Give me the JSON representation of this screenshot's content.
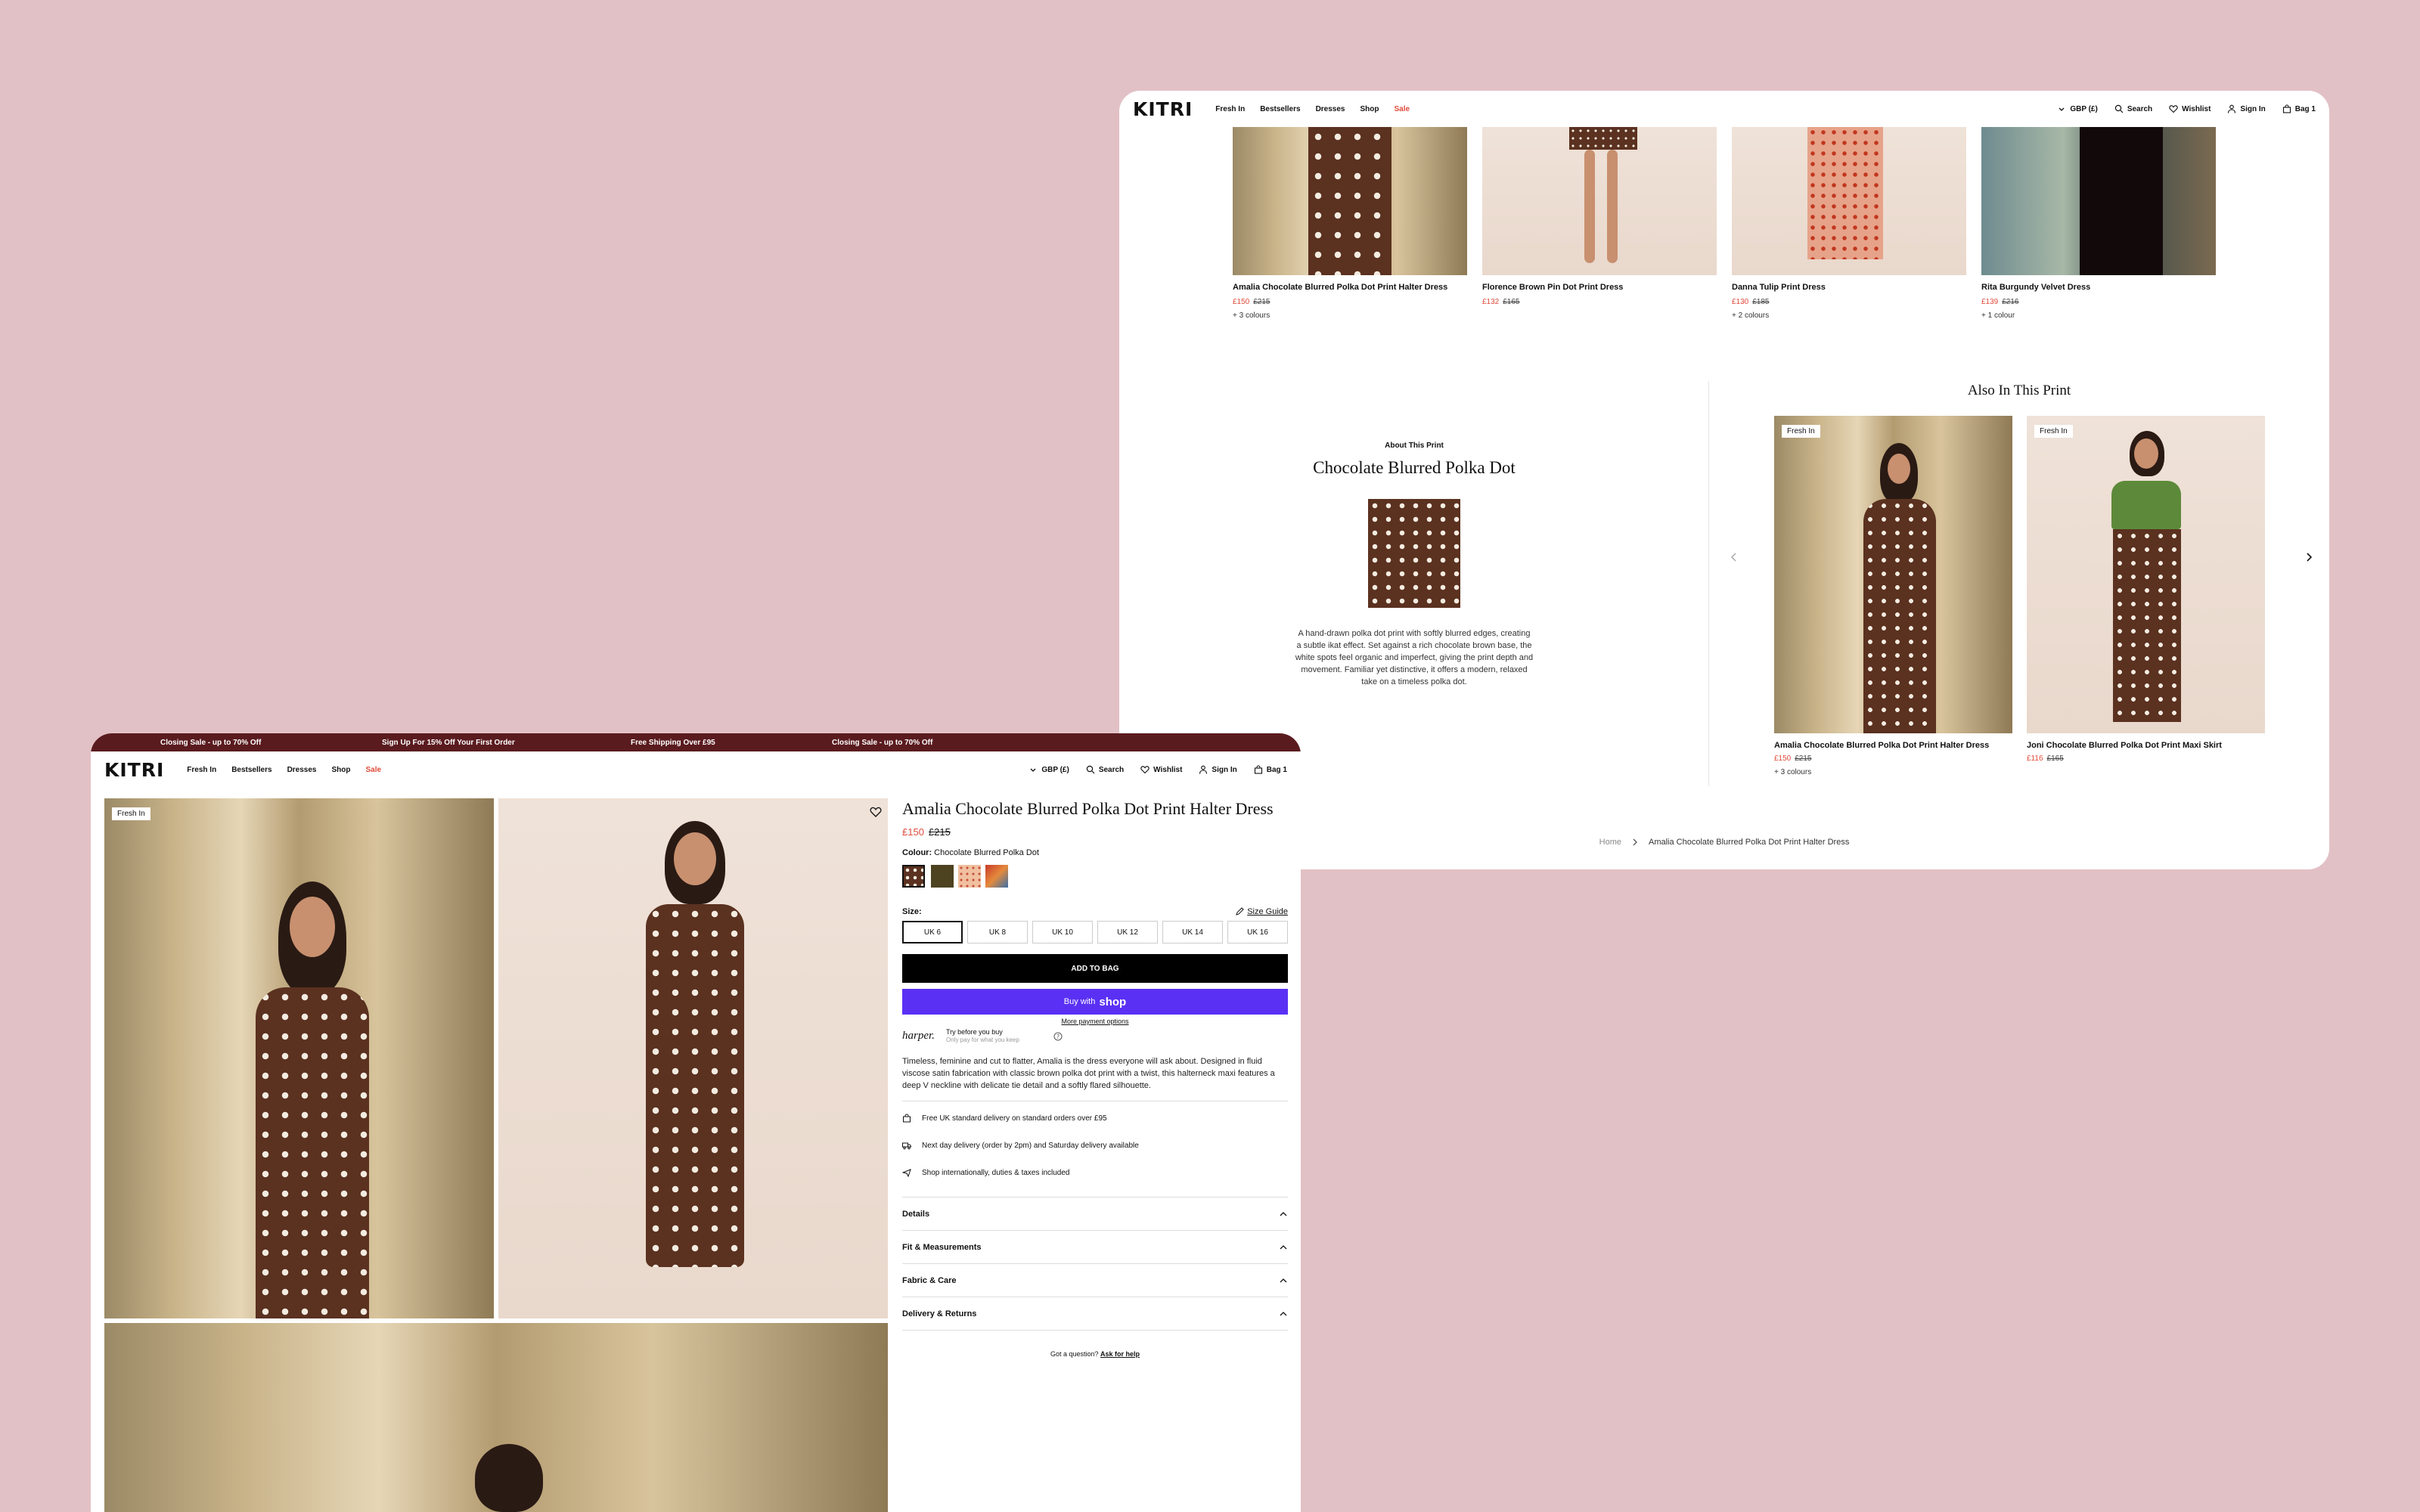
{
  "nav": {
    "logo": "KITRI",
    "links": [
      "Fresh In",
      "Bestsellers",
      "Dresses",
      "Shop",
      "Sale"
    ],
    "currency": "GBP (£)",
    "search": "Search",
    "wishlist": "Wishlist",
    "signin": "Sign In",
    "bag": "Bag 1"
  },
  "promo": [
    "Closing Sale - up to 70% Off",
    "Sign Up For 15% Off Your First Order",
    "Free Shipping Over £95",
    "Closing Sale - up to 70% Off"
  ],
  "top_products": [
    {
      "name": "Amalia Chocolate Blurred Polka Dot Print Halter Dress",
      "price": "£150",
      "was": "£215",
      "colours": "+ 3 colours"
    },
    {
      "name": "Florence Brown Pin Dot Print Dress",
      "price": "£132",
      "was": "£165",
      "colours": ""
    },
    {
      "name": "Danna Tulip Print Dress",
      "price": "£130",
      "was": "£185",
      "colours": "+ 2 colours"
    },
    {
      "name": "Rita Burgundy Velvet Dress",
      "price": "£139",
      "was": "£216",
      "colours": "+ 1 colour"
    }
  ],
  "about": {
    "eyebrow": "About This Print",
    "title": "Chocolate Blurred Polka Dot",
    "text": "A hand-drawn polka dot print with softly blurred edges, creating a subtle ikat effect. Set against a rich chocolate brown base, the white spots feel organic and imperfect, giving the print depth and movement. Familiar yet distinctive, it offers a modern, relaxed take on a timeless polka dot."
  },
  "also": {
    "title": "Also In This Print",
    "items": [
      {
        "tag": "Fresh In",
        "name": "Amalia Chocolate Blurred Polka Dot Print Halter Dress",
        "price": "£150",
        "was": "£215",
        "colours": "+ 3 colours"
      },
      {
        "tag": "Fresh In",
        "name": "Joni Chocolate Blurred Polka Dot Print Maxi Skirt",
        "price": "£116",
        "was": "£165",
        "colours": ""
      }
    ]
  },
  "breadcrumb": {
    "home": "Home",
    "current": "Amalia Chocolate Blurred Polka Dot Print Halter Dress"
  },
  "product": {
    "tag": "Fresh In",
    "title": "Amalia Chocolate Blurred Polka Dot Print Halter Dress",
    "price": "£150",
    "was": "£215",
    "colour_label": "Colour:",
    "colour_value": "Chocolate Blurred Polka Dot",
    "size_label": "Size:",
    "size_guide": "Size Guide",
    "sizes": [
      "UK 6",
      "UK 8",
      "UK 10",
      "UK 12",
      "UK 14",
      "UK 16"
    ],
    "add_to_bag": "ADD TO BAG",
    "buy_with": "Buy with",
    "shop": "shop",
    "more_payment": "More payment options",
    "harper": "harper.",
    "try_before": "Try before you buy",
    "only_pay": "Only pay for what you keep",
    "description": "Timeless, feminine and cut to flatter, Amalia is the dress everyone will ask about. Designed in fluid viscose satin fabrication with classic brown polka dot print with a twist, this halterneck maxi features a deep V neckline with delicate tie detail and a softly flared silhouette.",
    "features": [
      "Free UK standard delivery on standard orders over £95",
      "Next day delivery (order by 2pm) and Saturday delivery available",
      "Shop internationally, duties & taxes included"
    ],
    "accordions": [
      "Details",
      "Fit & Measurements",
      "Fabric & Care",
      "Delivery & Returns"
    ],
    "question": "Got a question?",
    "ask": "Ask for help"
  },
  "colors": {
    "accent": "#e04a3a",
    "promo_bg": "#5a1b1f",
    "shop_pay": "#5a31f4",
    "background": "#e2c1c6"
  }
}
